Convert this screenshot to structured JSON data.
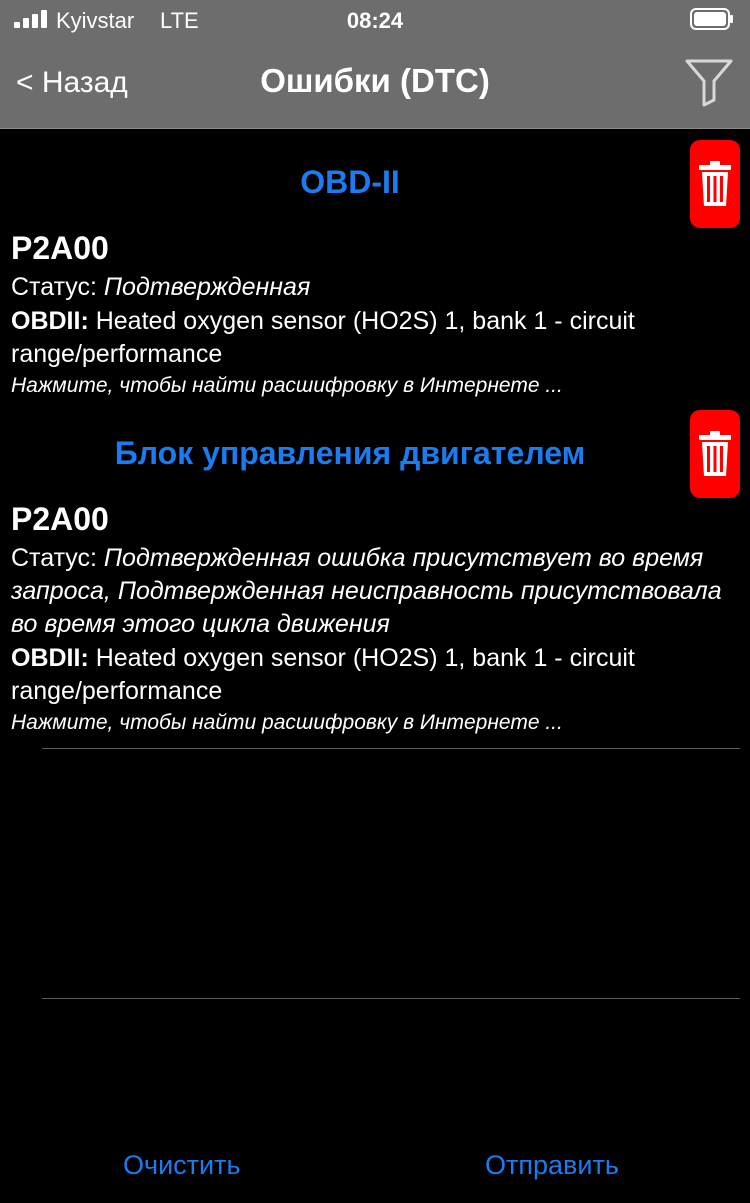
{
  "status_bar": {
    "carrier": "Kyivstar",
    "network": "LTE",
    "time": "08:24"
  },
  "nav": {
    "back_label": "< Назад",
    "title": "Ошибки (DTC)"
  },
  "sections": [
    {
      "title": "OBD-II",
      "code": "P2A00",
      "status_label": "Статус: ",
      "status_value": "Подтвержденная",
      "desc_label": "OBDII:",
      "desc_value": " Heated oxygen sensor (HO2S) 1, bank 1 - circuit range/performance",
      "hint": "Нажмите, чтобы найти расшифровку в Интернете ..."
    },
    {
      "title": "Блок управления двигателем",
      "code": "P2A00",
      "status_label": "Статус: ",
      "status_value": "Подтвержденная ошибка присутствует во время запроса, Подтвержденная неисправность присутствовала во время этого цикла движения",
      "desc_label": "OBDII:",
      "desc_value": " Heated oxygen sensor (HO2S) 1, bank 1 - circuit range/performance",
      "hint": "Нажмите, чтобы найти расшифровку в Интернете ..."
    }
  ],
  "toolbar": {
    "clear_label": "Очистить",
    "send_label": "Отправить"
  },
  "colors": {
    "accent": "#1a7cf0",
    "bar": "#6d6d6d",
    "delete": "#ff0000"
  },
  "icons": [
    "signal-icon",
    "battery-icon",
    "filter-icon",
    "trash-icon"
  ]
}
